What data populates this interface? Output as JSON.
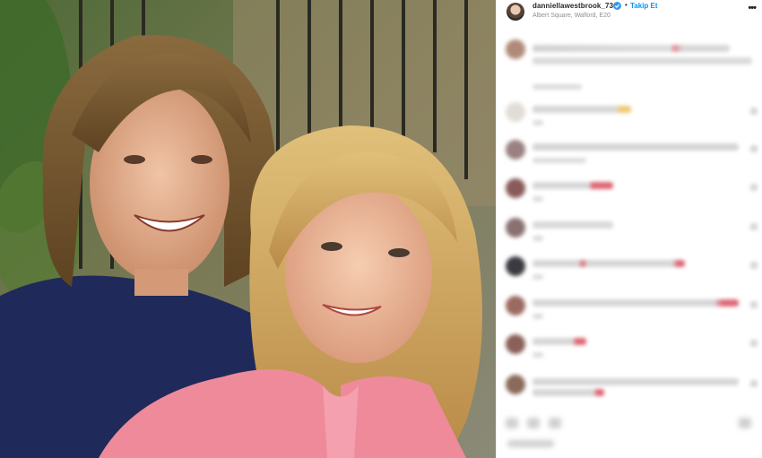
{
  "post": {
    "username": "danniellawestbrook_73",
    "verified": true,
    "separator": "•",
    "follow_label": "Takip Et",
    "location": "Albert Square, Walford, E20",
    "more_icon": "more-options-icon",
    "photo_alt": "Two smiling young people posing outdoors"
  },
  "comments": {
    "note": "",
    "items": [
      {
        "id": "c1"
      },
      {
        "id": "c2"
      },
      {
        "id": "c3"
      },
      {
        "id": "c4"
      },
      {
        "id": "c5"
      },
      {
        "id": "c6"
      },
      {
        "id": "c7"
      },
      {
        "id": "c8"
      },
      {
        "id": "c9"
      },
      {
        "id": "c10"
      }
    ]
  },
  "colors": {
    "accent": "#0095f6",
    "verified": "#3897f0",
    "text": "#262626",
    "muted": "#8e8e8e",
    "emoji_red": "#e0505c",
    "emoji_yellow": "#e8c15a"
  }
}
